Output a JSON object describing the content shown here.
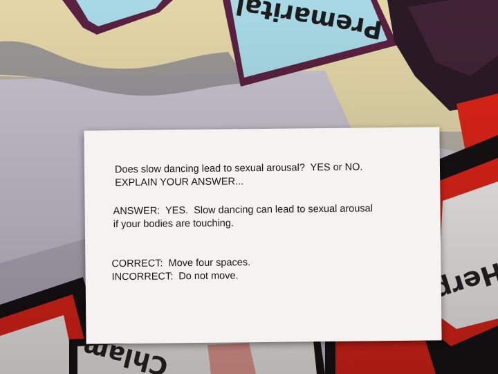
{
  "board_labels": {
    "top": "Premarital",
    "right": "Herp",
    "bottom": "Chlam"
  },
  "card": {
    "question": "Does slow dancing lead to sexual arousal?  YES or NO.\nEXPLAIN YOUR ANSWER...",
    "answer": "ANSWER:  YES.  Slow dancing can lead to sexual arousal\nif your bodies are touching.",
    "result": "CORRECT:  Move four spaces.\nINCORRECT:  Do not move."
  },
  "colors": {
    "card": "#f4f3f1",
    "board_gray": "#c9c6d0",
    "board_cream": "#e3d6a6",
    "space_blue": "#a8d9e6",
    "space_border": "#5a2140",
    "space_red": "#e02418",
    "space_black": "#161214"
  }
}
